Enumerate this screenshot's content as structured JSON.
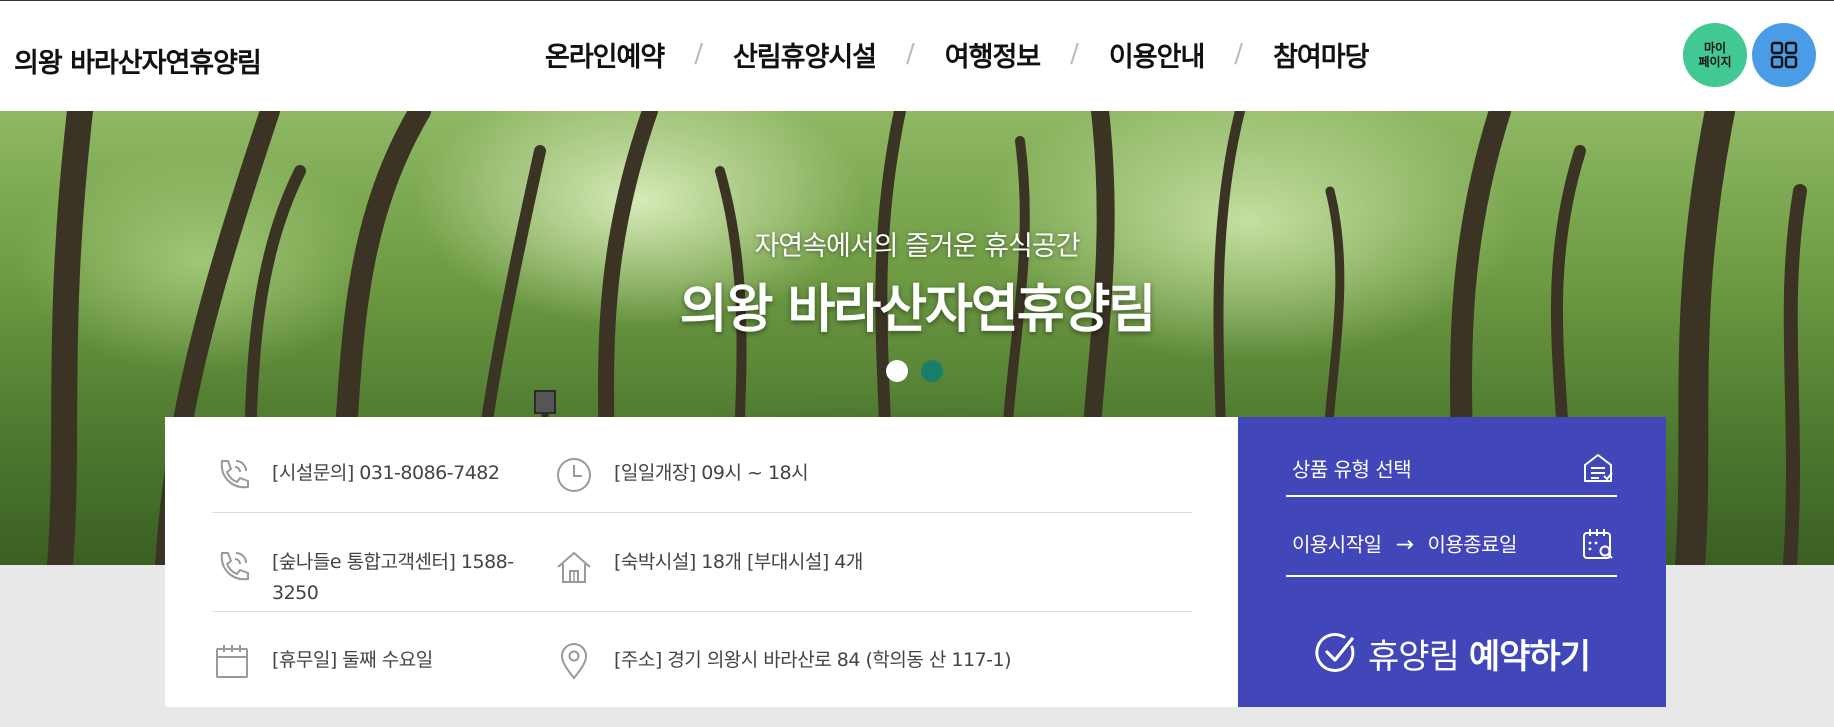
{
  "header": {
    "logo": "의왕 바라산자연휴양림",
    "nav": [
      "온라인예약",
      "산림휴양시설",
      "여행정보",
      "이용안내",
      "참여마당"
    ],
    "separator": "/",
    "mypage_label_1": "마이",
    "mypage_label_2": "페이지",
    "colors": {
      "mypage": "#41c893",
      "allmenu": "#4b9ce6"
    }
  },
  "hero": {
    "subtitle": "자연속에서의 즐거운 휴식공간",
    "title": "의왕 바라산자연휴양림",
    "slide_count": 2,
    "active_slide": 1
  },
  "info": {
    "phone": "[시설문의] 031-8086-7482",
    "hours": "[일일개장] 09시 ~ 18시",
    "callcenter_line1": "[숲나들e 통합고객센터] 1588-",
    "callcenter_line2": "3250",
    "facilities": "[숙박시설] 18개 [부대시설] 4개",
    "closed": "[휴무일] 둘째 수요일",
    "address": "[주소] 경기 의왕시 바라산로 84 (학의동 산 117-1)"
  },
  "reserve": {
    "product_type": "상품 유형 선택",
    "start_date": "이용시작일",
    "arrow": "→",
    "end_date": "이용종료일",
    "button_light": "휴양림",
    "button_bold": "예약하기",
    "color": "#4146b8"
  },
  "icons": [
    "phone-icon",
    "clock-icon",
    "house-icon",
    "calendar-icon",
    "location-pin-icon",
    "list-icon",
    "calendar-search-icon",
    "check-circle-icon",
    "grid-menu-icon"
  ]
}
